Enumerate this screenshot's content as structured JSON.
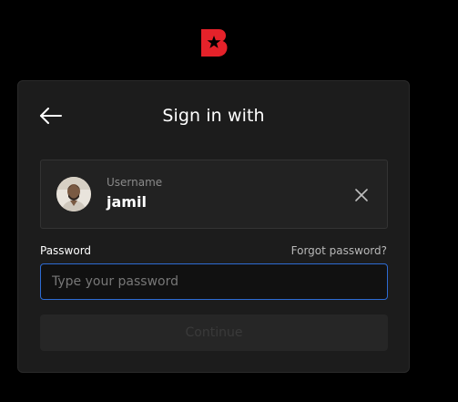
{
  "brand": {
    "logo_icon": "beast-logo-icon",
    "accent_color": "#e5222a"
  },
  "header": {
    "back_icon": "arrow-left-icon",
    "title": "Sign in with"
  },
  "account": {
    "avatar_icon": "user-avatar",
    "username_label": "Username",
    "username": "jamil",
    "clear_icon": "close-icon"
  },
  "password": {
    "label": "Password",
    "forgot_label": "Forgot password?",
    "value": "",
    "placeholder": "Type your password",
    "focus_color": "#2d6bd3"
  },
  "actions": {
    "continue_label": "Continue",
    "continue_enabled": false
  }
}
